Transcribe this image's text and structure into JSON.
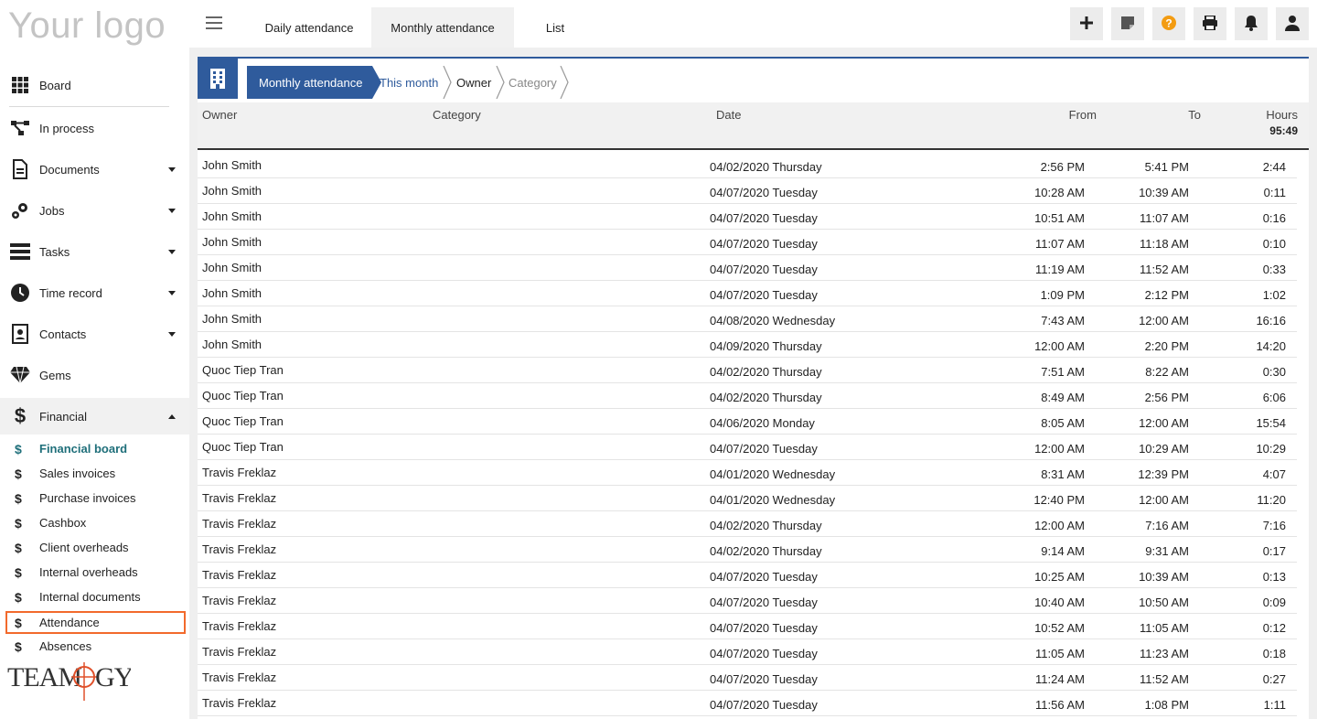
{
  "app": {
    "logo_text": "Your logo",
    "brand_logo": "TEAMOGY"
  },
  "sidebar": {
    "items": [
      {
        "label": "Board",
        "icon": "grid-icon"
      },
      {
        "label": "In process",
        "icon": "flow-icon"
      },
      {
        "label": "Documents",
        "icon": "document-icon"
      },
      {
        "label": "Jobs",
        "icon": "gears-icon"
      },
      {
        "label": "Tasks",
        "icon": "tasks-icon"
      },
      {
        "label": "Time record",
        "icon": "clock-icon"
      },
      {
        "label": "Contacts",
        "icon": "contacts-icon"
      },
      {
        "label": "Gems",
        "icon": "gem-icon"
      },
      {
        "label": "Financial",
        "icon": "dollar-icon"
      }
    ],
    "financial_sub": [
      {
        "label": "Financial board"
      },
      {
        "label": "Sales invoices"
      },
      {
        "label": "Purchase invoices"
      },
      {
        "label": "Cashbox"
      },
      {
        "label": "Client overheads"
      },
      {
        "label": "Internal overheads"
      },
      {
        "label": "Internal documents"
      },
      {
        "label": "Attendance"
      },
      {
        "label": "Absences"
      }
    ]
  },
  "topbar": {
    "tabs": [
      {
        "label": "Daily attendance"
      },
      {
        "label": "Monthly attendance"
      },
      {
        "label": "List"
      }
    ],
    "buttons": [
      "plus-icon",
      "note-icon",
      "help-icon",
      "print-icon",
      "bell-icon",
      "user-icon"
    ],
    "help_color": "#f39c12"
  },
  "breadcrumb": {
    "items": [
      "Monthly attendance",
      "This month",
      "Owner",
      "Category"
    ]
  },
  "table": {
    "headers": {
      "owner": "Owner",
      "category": "Category",
      "date": "Date",
      "from": "From",
      "to": "To",
      "hours": "Hours"
    },
    "total_hours": "95:49",
    "rows": [
      {
        "owner": "John Smith",
        "date": "04/02/2020 Thursday",
        "from": "2:56 PM",
        "to": "5:41 PM",
        "hours": "2:44"
      },
      {
        "owner": "John Smith",
        "date": "04/07/2020 Tuesday",
        "from": "10:28 AM",
        "to": "10:39 AM",
        "hours": "0:11"
      },
      {
        "owner": "John Smith",
        "date": "04/07/2020 Tuesday",
        "from": "10:51 AM",
        "to": "11:07 AM",
        "hours": "0:16"
      },
      {
        "owner": "John Smith",
        "date": "04/07/2020 Tuesday",
        "from": "11:07 AM",
        "to": "11:18 AM",
        "hours": "0:10"
      },
      {
        "owner": "John Smith",
        "date": "04/07/2020 Tuesday",
        "from": "11:19 AM",
        "to": "11:52 AM",
        "hours": "0:33"
      },
      {
        "owner": "John Smith",
        "date": "04/07/2020 Tuesday",
        "from": "1:09 PM",
        "to": "2:12 PM",
        "hours": "1:02"
      },
      {
        "owner": "John Smith",
        "date": "04/08/2020 Wednesday",
        "from": "7:43 AM",
        "to": "12:00 AM",
        "hours": "16:16"
      },
      {
        "owner": "John Smith",
        "date": "04/09/2020 Thursday",
        "from": "12:00 AM",
        "to": "2:20 PM",
        "hours": "14:20"
      },
      {
        "owner": "Quoc Tiep Tran",
        "date": "04/02/2020 Thursday",
        "from": "7:51 AM",
        "to": "8:22 AM",
        "hours": "0:30"
      },
      {
        "owner": "Quoc Tiep Tran",
        "date": "04/02/2020 Thursday",
        "from": "8:49 AM",
        "to": "2:56 PM",
        "hours": "6:06"
      },
      {
        "owner": "Quoc Tiep Tran",
        "date": "04/06/2020 Monday",
        "from": "8:05 AM",
        "to": "12:00 AM",
        "hours": "15:54"
      },
      {
        "owner": "Quoc Tiep Tran",
        "date": "04/07/2020 Tuesday",
        "from": "12:00 AM",
        "to": "10:29 AM",
        "hours": "10:29"
      },
      {
        "owner": "Travis Freklaz",
        "date": "04/01/2020 Wednesday",
        "from": "8:31 AM",
        "to": "12:39 PM",
        "hours": "4:07"
      },
      {
        "owner": "Travis Freklaz",
        "date": "04/01/2020 Wednesday",
        "from": "12:40 PM",
        "to": "12:00 AM",
        "hours": "11:20"
      },
      {
        "owner": "Travis Freklaz",
        "date": "04/02/2020 Thursday",
        "from": "12:00 AM",
        "to": "7:16 AM",
        "hours": "7:16"
      },
      {
        "owner": "Travis Freklaz",
        "date": "04/02/2020 Thursday",
        "from": "9:14 AM",
        "to": "9:31 AM",
        "hours": "0:17"
      },
      {
        "owner": "Travis Freklaz",
        "date": "04/07/2020 Tuesday",
        "from": "10:25 AM",
        "to": "10:39 AM",
        "hours": "0:13"
      },
      {
        "owner": "Travis Freklaz",
        "date": "04/07/2020 Tuesday",
        "from": "10:40 AM",
        "to": "10:50 AM",
        "hours": "0:09"
      },
      {
        "owner": "Travis Freklaz",
        "date": "04/07/2020 Tuesday",
        "from": "10:52 AM",
        "to": "11:05 AM",
        "hours": "0:12"
      },
      {
        "owner": "Travis Freklaz",
        "date": "04/07/2020 Tuesday",
        "from": "11:05 AM",
        "to": "11:23 AM",
        "hours": "0:18"
      },
      {
        "owner": "Travis Freklaz",
        "date": "04/07/2020 Tuesday",
        "from": "11:24 AM",
        "to": "11:52 AM",
        "hours": "0:27"
      },
      {
        "owner": "Travis Freklaz",
        "date": "04/07/2020 Tuesday",
        "from": "11:56 AM",
        "to": "1:08 PM",
        "hours": "1:11"
      }
    ]
  },
  "colors": {
    "accent": "#2f5b9c",
    "highlight": "#f26a2c",
    "active_sub": "#1f6f7a"
  }
}
